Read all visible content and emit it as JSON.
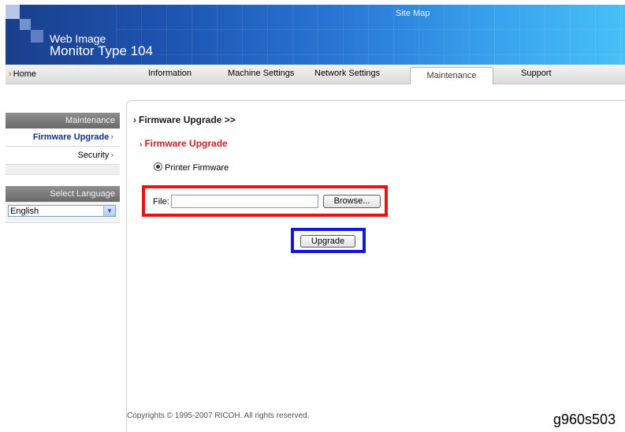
{
  "header": {
    "logo_line1": "Web Image",
    "logo_line2": "Monitor Type 104",
    "site_map": "Site Map"
  },
  "nav": {
    "home": "Home",
    "tabs": [
      {
        "label": "Information"
      },
      {
        "label": "Machine Settings"
      },
      {
        "label": "Network Settings"
      },
      {
        "label": "Maintenance",
        "active": true
      },
      {
        "label": "Support"
      }
    ]
  },
  "sidebar": {
    "section_title": "Maintenance",
    "items": [
      {
        "label": "Firmware Upgrade",
        "active": true
      },
      {
        "label": "Security"
      }
    ],
    "language_title": "Select Language",
    "language_selected": "English"
  },
  "main": {
    "breadcrumb": "Firmware Upgrade >>",
    "section_title": "Firmware Upgrade",
    "radio_label": "Printer Firmware",
    "file_label": "File:",
    "file_value": "",
    "browse_button": "Browse...",
    "upgrade_button": "Upgrade"
  },
  "annotations": {
    "file_box_color": "#ee1111",
    "upgrade_box_color": "#1116e0"
  },
  "footer": {
    "copyright": "Copyrights © 1995-2007 RICOH. All rights reserved.",
    "figure_id": "g960s503"
  }
}
